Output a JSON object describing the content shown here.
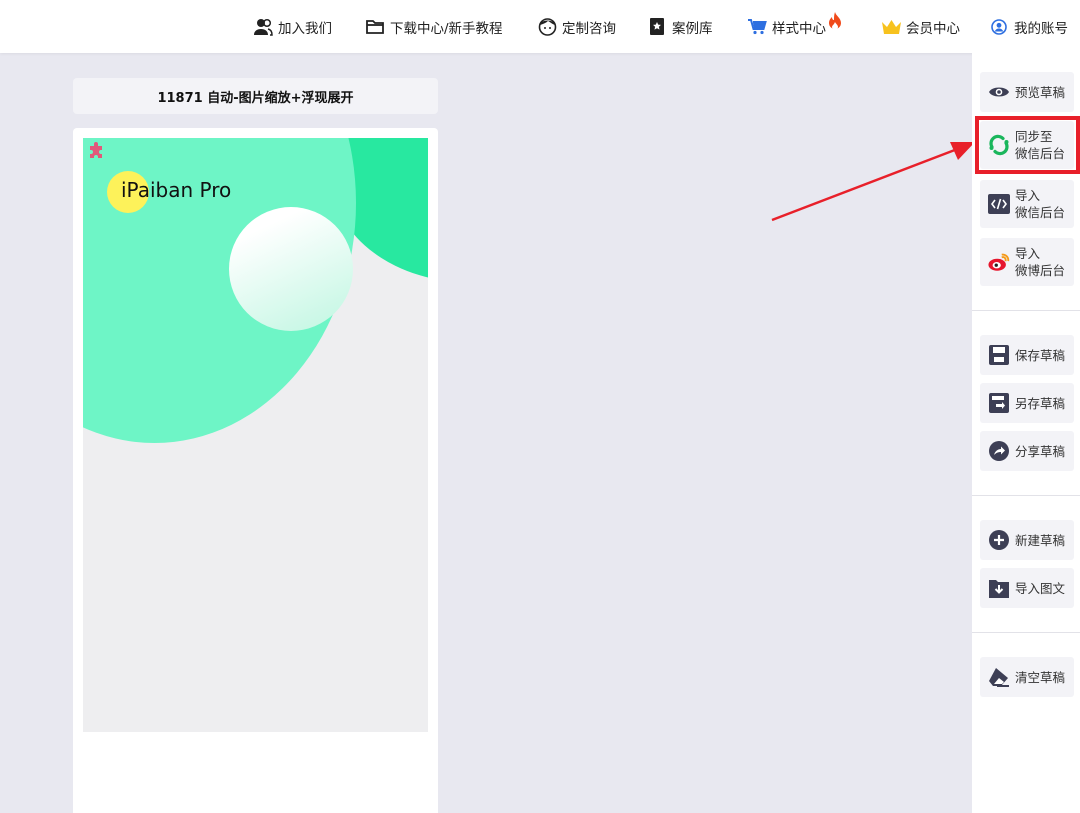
{
  "nav": {
    "join": "加入我们",
    "download": "下载中心/新手教程",
    "custom": "定制咨询",
    "cases": "案例库",
    "styles": "样式中心",
    "vip": "会员中心",
    "account": "我的账号"
  },
  "template": {
    "title": "11871 自动-图片缩放+浮现展开",
    "brand": "iPaiban Pro"
  },
  "sidebar": {
    "preview": "预览草稿",
    "sync_line1": "同步至",
    "sync_line2": "微信后台",
    "import_wx_line1": "导入",
    "import_wx_line2": "微信后台",
    "import_wb_line1": "导入",
    "import_wb_line2": "微博后台",
    "save": "保存草稿",
    "save_as": "另存草稿",
    "share": "分享草稿",
    "new": "新建草稿",
    "import_article": "导入图文",
    "clear": "清空草稿"
  },
  "colors": {
    "highlight": "#e8202a",
    "mint": "#6ef5c6",
    "green": "#28e8a0",
    "yellow": "#fdf25a"
  },
  "icons": [
    "users-icon",
    "folder-icon",
    "avatar-icon",
    "star-book-icon",
    "cart-icon",
    "flame-icon",
    "crown-icon",
    "user-circle-icon",
    "eye-icon",
    "wechat-sync-icon",
    "code-icon",
    "weibo-icon",
    "floppy-icon",
    "save-as-icon",
    "share-icon",
    "plus-circle-icon",
    "import-icon",
    "eraser-icon",
    "puzzle-icon"
  ]
}
